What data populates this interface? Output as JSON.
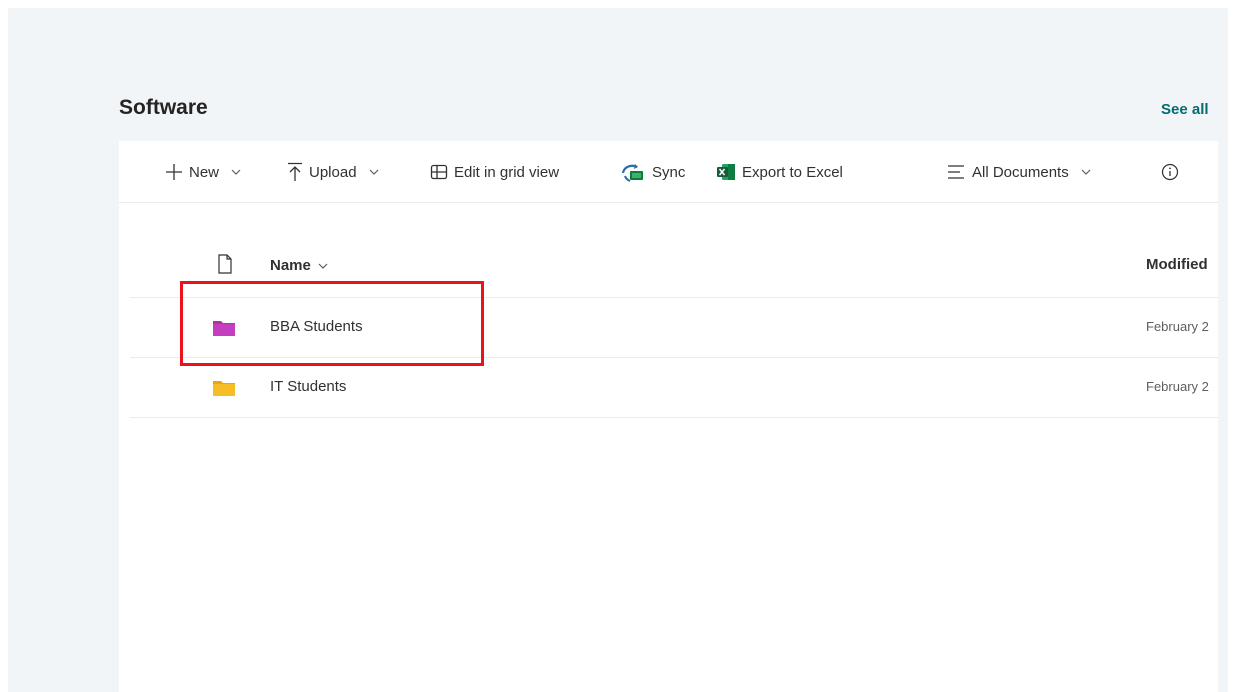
{
  "section": {
    "title": "Software",
    "see_all": "See all"
  },
  "toolbar": {
    "new_label": "New",
    "upload_label": "Upload",
    "grid_label": "Edit in grid view",
    "sync_label": "Sync",
    "export_label": "Export to Excel",
    "view_label": "All Documents"
  },
  "list": {
    "columns": {
      "name": "Name",
      "modified": "Modified"
    },
    "rows": [
      {
        "name": "BBA Students",
        "modified": "February 2",
        "folder_color": "#c43fbd",
        "highlighted": true
      },
      {
        "name": "IT Students",
        "modified": "February 2",
        "folder_color": "#f5bd26",
        "highlighted": false
      }
    ]
  },
  "colors": {
    "accent": "#036c70",
    "highlight": "#e8131b",
    "background": "#f2f5f8"
  }
}
